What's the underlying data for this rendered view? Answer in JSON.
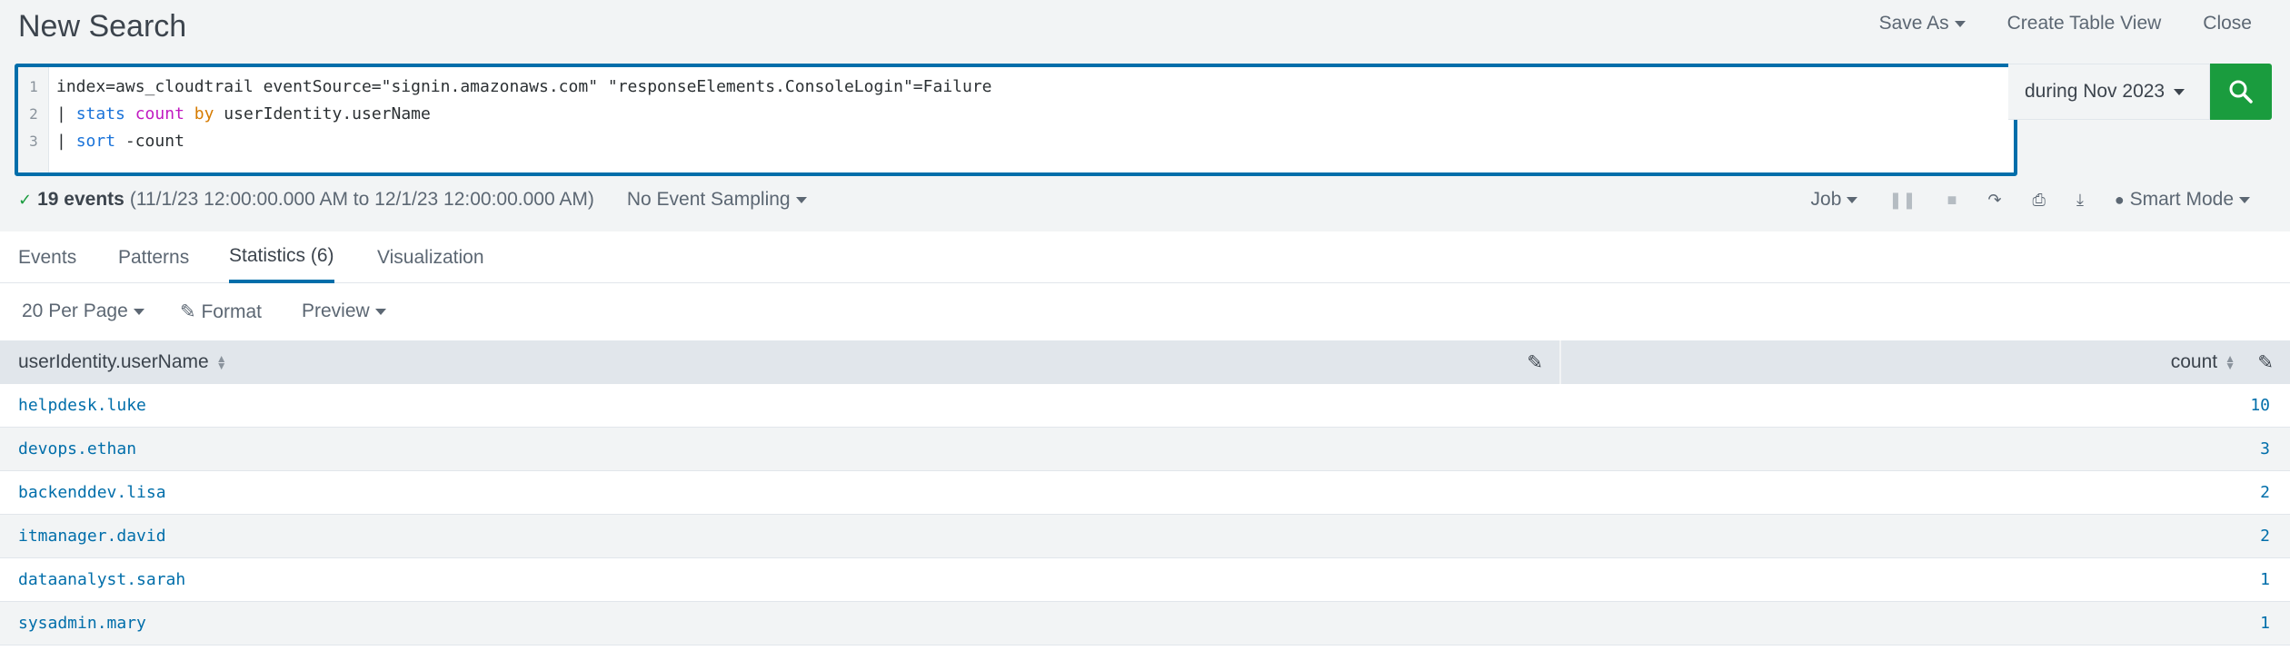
{
  "header": {
    "title": "New Search",
    "save_as": "Save As",
    "create_table_view": "Create Table View",
    "close": "Close"
  },
  "search": {
    "lines": [
      {
        "num": "1",
        "parts": [
          {
            "t": "index=aws_cloudtrail eventSource=\"signin.amazonaws.com\" \"responseElements.ConsoleLogin\"=Failure",
            "c": ""
          }
        ]
      },
      {
        "num": "2",
        "parts": [
          {
            "t": "| ",
            "c": "pipe"
          },
          {
            "t": "stats",
            "c": "kw-blue"
          },
          {
            "t": " ",
            "c": ""
          },
          {
            "t": "count",
            "c": "kw-pink"
          },
          {
            "t": " ",
            "c": ""
          },
          {
            "t": "by",
            "c": "kw-orange"
          },
          {
            "t": " userIdentity.userName",
            "c": ""
          }
        ]
      },
      {
        "num": "3",
        "parts": [
          {
            "t": "| ",
            "c": "pipe"
          },
          {
            "t": "sort",
            "c": "kw-blue"
          },
          {
            "t": " -count",
            "c": ""
          }
        ]
      }
    ],
    "time_range": "during Nov 2023"
  },
  "status": {
    "events": "19 events",
    "range": "(11/1/23 12:00:00.000 AM to 12/1/23 12:00:00.000 AM)",
    "sampling": "No Event Sampling",
    "job": "Job",
    "mode": "Smart Mode"
  },
  "tabs": [
    {
      "label": "Events"
    },
    {
      "label": "Patterns"
    },
    {
      "label": "Statistics (6)"
    },
    {
      "label": "Visualization"
    }
  ],
  "results_bar": {
    "per_page": "20 Per Page",
    "format": "Format",
    "preview": "Preview"
  },
  "table": {
    "columns": [
      "userIdentity.userName",
      "count"
    ],
    "rows": [
      {
        "user": "helpdesk.luke",
        "count": "10"
      },
      {
        "user": "devops.ethan",
        "count": "3"
      },
      {
        "user": "backenddev.lisa",
        "count": "2"
      },
      {
        "user": "itmanager.david",
        "count": "2"
      },
      {
        "user": "dataanalyst.sarah",
        "count": "1"
      },
      {
        "user": "sysadmin.mary",
        "count": "1"
      }
    ]
  },
  "colors": {
    "accent": "#006eaa",
    "search_button": "#1a9c3e",
    "link": "#006eaa"
  }
}
